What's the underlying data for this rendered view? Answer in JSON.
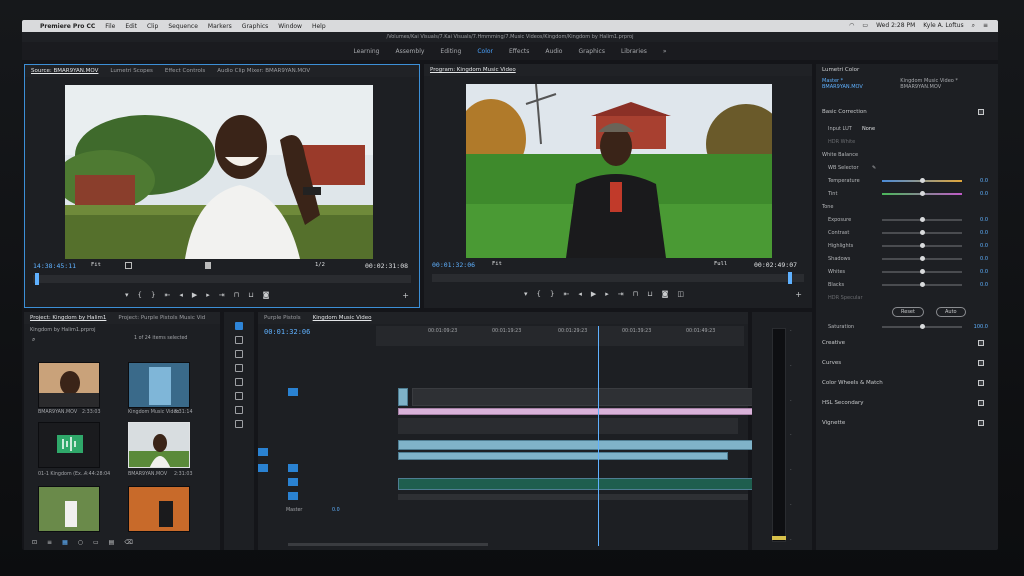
{
  "menubar": {
    "app": "Premiere Pro CC",
    "items": [
      "File",
      "Edit",
      "Clip",
      "Sequence",
      "Markers",
      "Graphics",
      "Window",
      "Help"
    ],
    "clock": "Wed 2:28 PM",
    "user": "Kyle A. Loftus"
  },
  "window_title": "/Volumes/Kai Visuals/7.Kai Visuals/7.Hmmming/7.Music Videos/Kingdom/Kingdom by Halim1.prproj",
  "workspaces": [
    "Learning",
    "Assembly",
    "Editing",
    "Color",
    "Effects",
    "Audio",
    "Graphics",
    "Libraries",
    "»"
  ],
  "active_workspace": "Color",
  "source": {
    "tabs": [
      "Source: BMAR9YAN.MOV",
      "Lumetri Scopes",
      "Effect Controls",
      "Audio Clip Mixer: BMAR9YAN.MOV"
    ],
    "timecode_in": "14:38:45:11",
    "fit": "Fit",
    "fraction": "1/2",
    "timecode_out": "00:02:31:08"
  },
  "program": {
    "tab": "Program: Kingdom Music Video",
    "timecode_in": "00:01:32:06",
    "fit": "Fit",
    "quality": "Full",
    "timecode_out": "00:02:49:07"
  },
  "transport_icons": [
    "marker-icon",
    "in-point-icon",
    "out-point-icon",
    "go-to-in-icon",
    "step-back-icon",
    "play-icon",
    "step-forward-icon",
    "go-to-out-icon",
    "insert-icon",
    "overwrite-icon",
    "export-frame-icon"
  ],
  "lumetri": {
    "title": "Lumetri Color",
    "master": "Master * BMAR9YAN.MOV",
    "sequence": "Kingdom Music Video * BMAR9YAN.MOV",
    "basic_correction": "Basic Correction",
    "input_lut_label": "Input LUT",
    "input_lut_value": "None",
    "hdr_white": "HDR White",
    "white_balance": "White Balance",
    "wb_selector": "WB Selector",
    "wb_rows": [
      {
        "label": "Temperature",
        "value": "0.0",
        "pos": 0.5
      },
      {
        "label": "Tint",
        "value": "0.0",
        "pos": 0.5
      }
    ],
    "tone": "Tone",
    "tone_rows": [
      {
        "label": "Exposure",
        "value": "0.0",
        "pos": 0.5
      },
      {
        "label": "Contrast",
        "value": "0.0",
        "pos": 0.5
      },
      {
        "label": "Highlights",
        "value": "0.0",
        "pos": 0.5
      },
      {
        "label": "Shadows",
        "value": "0.0",
        "pos": 0.5
      },
      {
        "label": "Whites",
        "value": "0.0",
        "pos": 0.5
      },
      {
        "label": "Blacks",
        "value": "0.0",
        "pos": 0.5
      }
    ],
    "hdr_specular": "HDR Specular",
    "reset": "Reset",
    "auto": "Auto",
    "saturation_label": "Saturation",
    "saturation_value": "100.0",
    "sections": [
      "Creative",
      "Curves",
      "Color Wheels & Match",
      "HSL Secondary",
      "Vignette"
    ]
  },
  "project": {
    "tabs": [
      "Project: Kingdom by Halim1",
      "Project: Purple Pistols Music Vid"
    ],
    "file": "Kingdom by Halim1.prproj",
    "count": "1 of 24 items selected",
    "items": [
      {
        "name": "BMAR9YAN.MOV",
        "duration": "2:33:03"
      },
      {
        "name": "Kingdom Music Video",
        "duration": "3:31:14"
      },
      {
        "name": "01-1 Kingdom (Ex...",
        "duration": "4:44:28:04"
      },
      {
        "name": "BMAR9YAN.MOV",
        "duration": "2:31:03"
      }
    ]
  },
  "timeline": {
    "tabs": [
      "Purple Pistols",
      "Kingdom Music Video"
    ],
    "timecode": "00:01:32:06",
    "ruler": [
      "00:01:09:23",
      "00:01:19:23",
      "00:01:29:23",
      "00:01:39:23",
      "00:01:49:23"
    ],
    "master_label": "Master",
    "master_value": "0.0"
  }
}
